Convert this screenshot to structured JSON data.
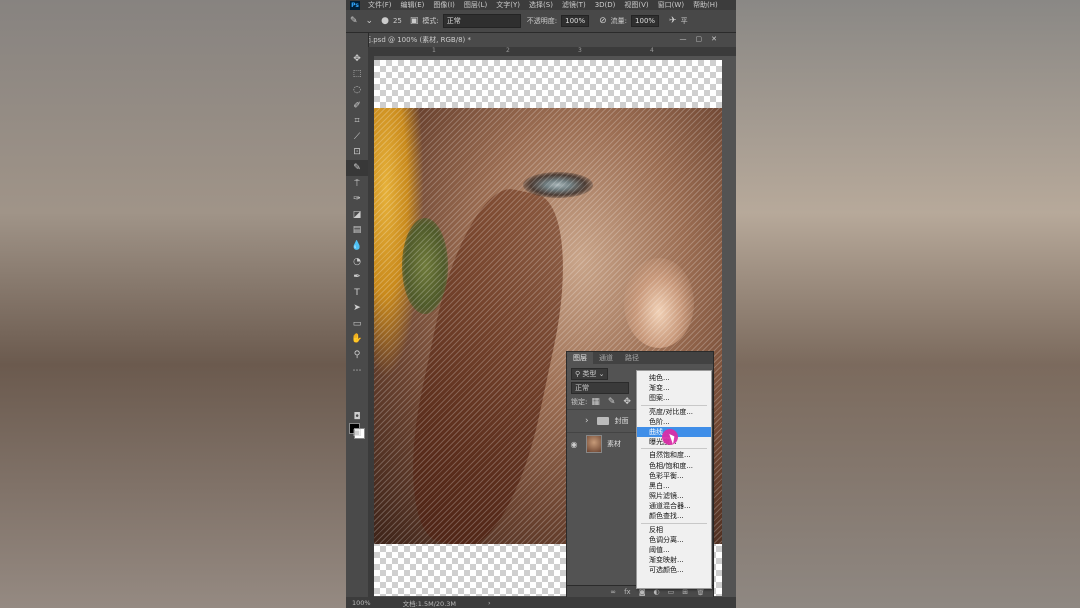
{
  "menubar": {
    "logo": "Ps",
    "items": [
      "文件(F)",
      "编辑(E)",
      "图像(I)",
      "图层(L)",
      "文字(Y)",
      "选择(S)",
      "滤镜(T)",
      "3D(D)",
      "视图(V)",
      "窗口(W)",
      "帮助(H)"
    ]
  },
  "options": {
    "brush_size": "25",
    "mode_label": "模式:",
    "mode_value": "正常",
    "opacity_label": "不透明度:",
    "opacity_value": "100%",
    "flow_label": "流量:",
    "flow_value": "100%",
    "smooth_label": "平"
  },
  "document": {
    "tab_title": "面.psd @ 100% (素材, RGB/8) *"
  },
  "ruler": {
    "marks": [
      "1",
      "2",
      "3",
      "4"
    ]
  },
  "layers_panel": {
    "tabs": [
      "图层",
      "通道",
      "路径"
    ],
    "filter_label": "类型",
    "blend_mode": "正常",
    "lock_label": "锁定:",
    "layers": [
      {
        "name": "封面",
        "type": "folder"
      },
      {
        "name": "素材",
        "type": "image"
      }
    ],
    "footer_fx": "fx"
  },
  "context_menu": {
    "groups": [
      [
        "纯色...",
        "渐变...",
        "图案..."
      ],
      [
        "亮度/对比度...",
        "色阶...",
        "曲线...",
        "曝光度..."
      ],
      [
        "自然饱和度...",
        "色相/饱和度...",
        "色彩平衡...",
        "黑白...",
        "照片滤镜...",
        "通道混合器...",
        "颜色查找..."
      ],
      [
        "反相",
        "色调分离...",
        "阈值...",
        "渐变映射...",
        "可选颜色..."
      ]
    ],
    "highlighted": "曲线..."
  },
  "status": {
    "zoom": "100%",
    "doc_info": "文档:1.5M/20.3M"
  },
  "colors": {
    "highlight": "#3f8ee8",
    "cursor": "#d92ea8",
    "panel_bg": "#535353"
  }
}
